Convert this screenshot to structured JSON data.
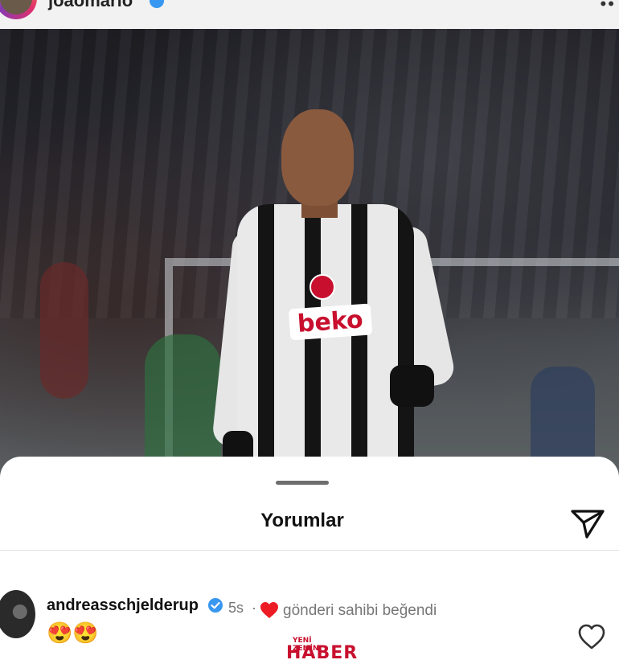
{
  "header": {
    "username": "joaomario",
    "more_icon": "more-dots-icon"
  },
  "post": {
    "photo_description": "",
    "sponsor_text": "beko"
  },
  "comments_sheet": {
    "title": "Yorumlar",
    "send_icon": "paper-plane-icon",
    "comments": [
      {
        "author": "andreasschjelderup",
        "verified": true,
        "time": "5s",
        "separator": "·",
        "liked_by_author_text": "gönderi sahibi beğendi",
        "text": "😍😍",
        "like_icon": "heart-outline-icon"
      }
    ]
  },
  "watermark": {
    "top": "YENİ ZEMİN",
    "bottom": "HABER"
  },
  "colors": {
    "accent_blue": "#3897f0",
    "heart_red": "#ed1c24",
    "watermark_red": "#c8102e"
  }
}
